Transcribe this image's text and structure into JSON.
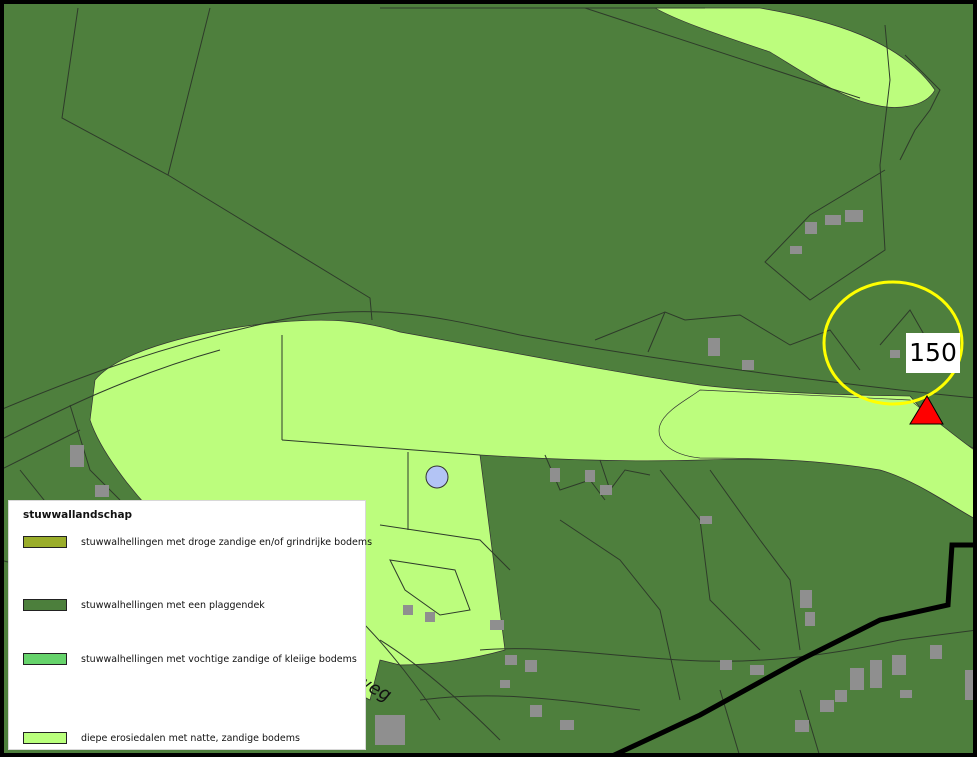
{
  "map": {
    "marker_label": "150",
    "road_label": "weg"
  },
  "legend": {
    "title": "stuwwallandschap",
    "items": [
      {
        "label": "stuwwalhellingen met droge zandige en/of grindrijke bodems",
        "color": "#9aad2a"
      },
      {
        "label": "stuwwalhellingen met een plaggendek",
        "color": "#4c7f3c"
      },
      {
        "label": "stuwwalhellingen met vochtige zandige of kleiige bodems",
        "color": "#66d36b"
      },
      {
        "label": "diepe erosiedalen met natte, zandige bodems",
        "color": "#b9ff7c"
      }
    ]
  },
  "colors": {
    "dark_green": "#4e7f3d",
    "light_green": "#bcfd7d",
    "building": "#8f8f8f",
    "highlight_circle": "#ffff00",
    "marker": "#ff0000",
    "pond": "#b3c4f5"
  }
}
